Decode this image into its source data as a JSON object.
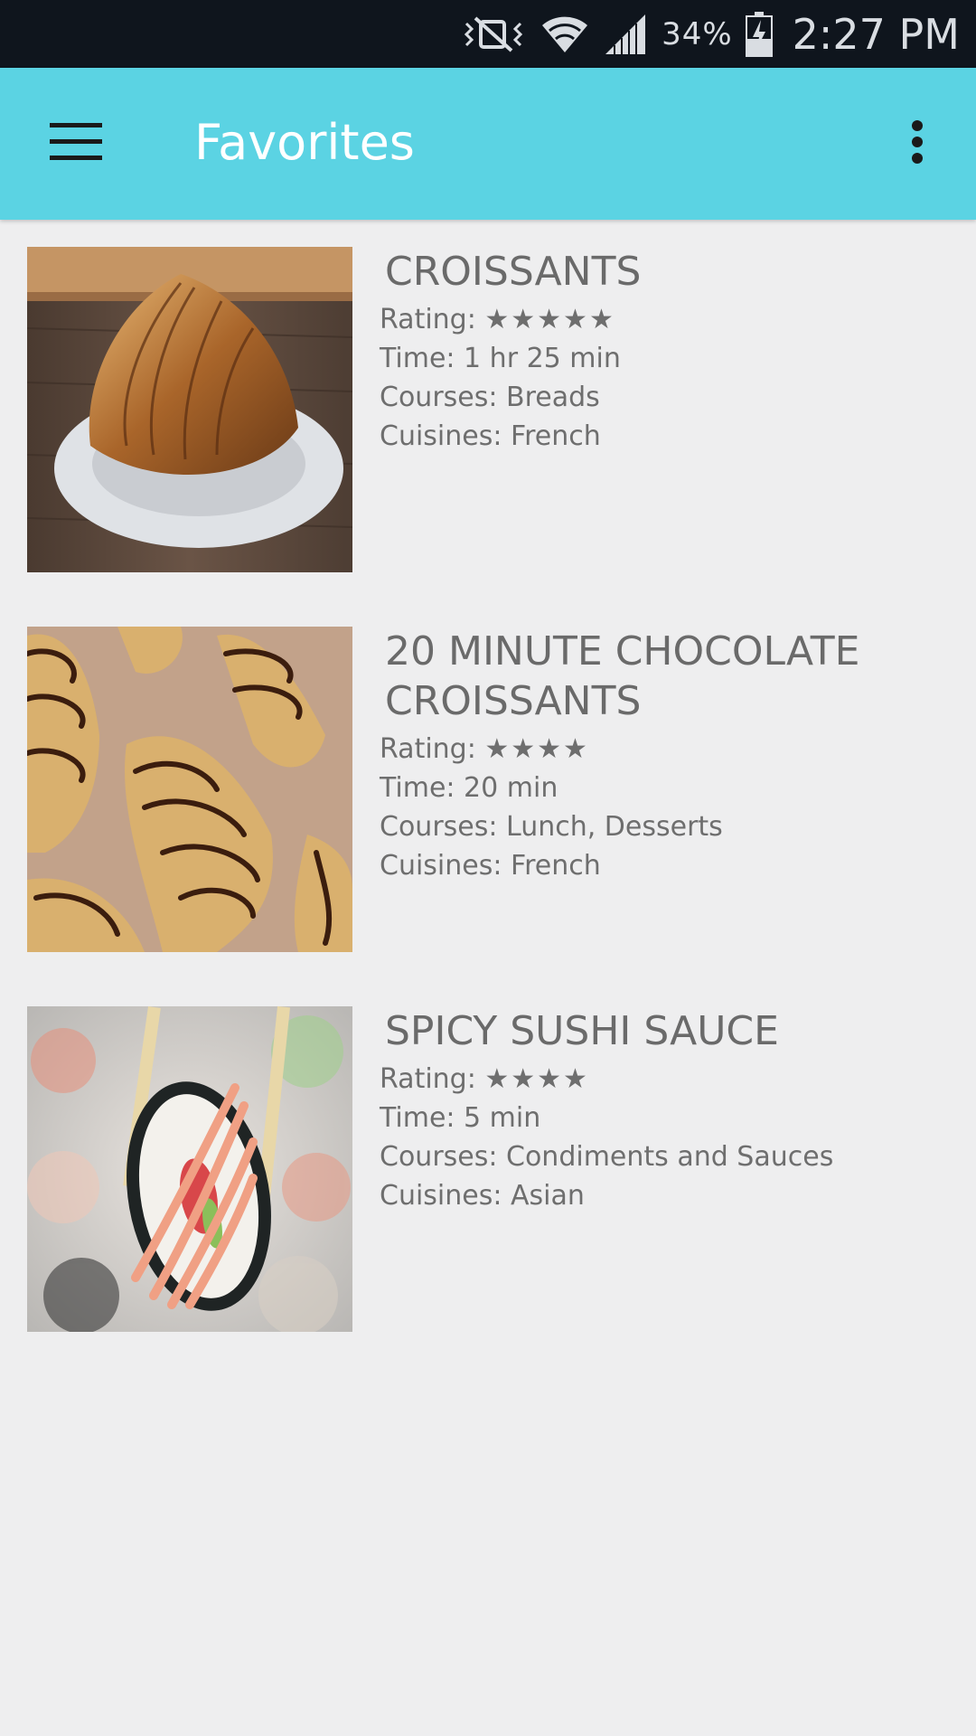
{
  "status_bar": {
    "battery": "34%",
    "time": "2:27 PM",
    "icons": [
      "vibrate-mute-icon",
      "wifi-icon",
      "signal-icon",
      "battery-charging-icon"
    ]
  },
  "app_bar": {
    "title": "Favorites",
    "background": "#5bd3e3",
    "menu_icon": "hamburger-menu-icon",
    "overflow_icon": "more-vert-icon"
  },
  "recipes": [
    {
      "title": "CROISSANTS",
      "rating_label": "Rating: ",
      "stars": "★★★★★",
      "rating": 5,
      "time": "Time: 1 hr 25 min",
      "courses": "Courses: Breads",
      "cuisines": "Cuisines: French",
      "image": "croissant-photo"
    },
    {
      "title": "20 MINUTE CHOCOLATE CROISSANTS",
      "rating_label": "Rating: ",
      "stars": "★★★★",
      "rating": 4,
      "time": "Time: 20 min",
      "courses": "Courses: Lunch, Desserts",
      "cuisines": "Cuisines: French",
      "image": "chocolate-croissants-photo"
    },
    {
      "title": "SPICY SUSHI SAUCE",
      "rating_label": "Rating: ",
      "stars": "★★★★",
      "rating": 4,
      "time": "Time: 5 min",
      "courses": "Courses: Condiments and Sauces",
      "cuisines": "Cuisines: Asian",
      "image": "sushi-roll-photo"
    }
  ]
}
